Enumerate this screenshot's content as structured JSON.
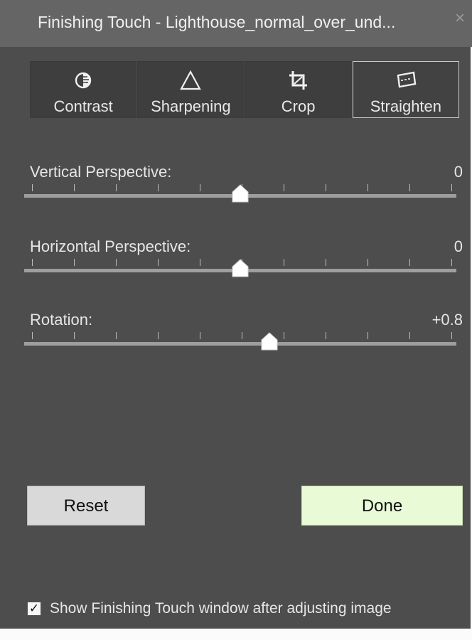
{
  "window": {
    "title": "Finishing Touch - Lighthouse_normal_over_und...",
    "close_glyph": "×"
  },
  "tabs": [
    {
      "label": "Contrast",
      "icon": "contrast-icon",
      "active": false
    },
    {
      "label": "Sharpening",
      "icon": "sharpening-icon",
      "active": false
    },
    {
      "label": "Crop",
      "icon": "crop-icon",
      "active": false
    },
    {
      "label": "Straighten",
      "icon": "straighten-icon",
      "active": true
    }
  ],
  "sliders": [
    {
      "label": "Vertical Perspective:",
      "value": "0",
      "level": 0.5
    },
    {
      "label": "Horizontal Perspective:",
      "value": "0",
      "level": 0.5
    },
    {
      "label": "Rotation:",
      "value": "+0.8",
      "level": 0.57
    }
  ],
  "buttons": {
    "reset_label": "Reset",
    "done_label": "Done"
  },
  "footer": {
    "checkbox_checked": true,
    "checkbox_label": "Show Finishing Touch window after adjusting image"
  },
  "colors": {
    "window_bg": "#4d4d4d",
    "titlebar_bg": "#656565",
    "done_bg": "#e8fbd6",
    "reset_bg": "#d9d9d9"
  }
}
